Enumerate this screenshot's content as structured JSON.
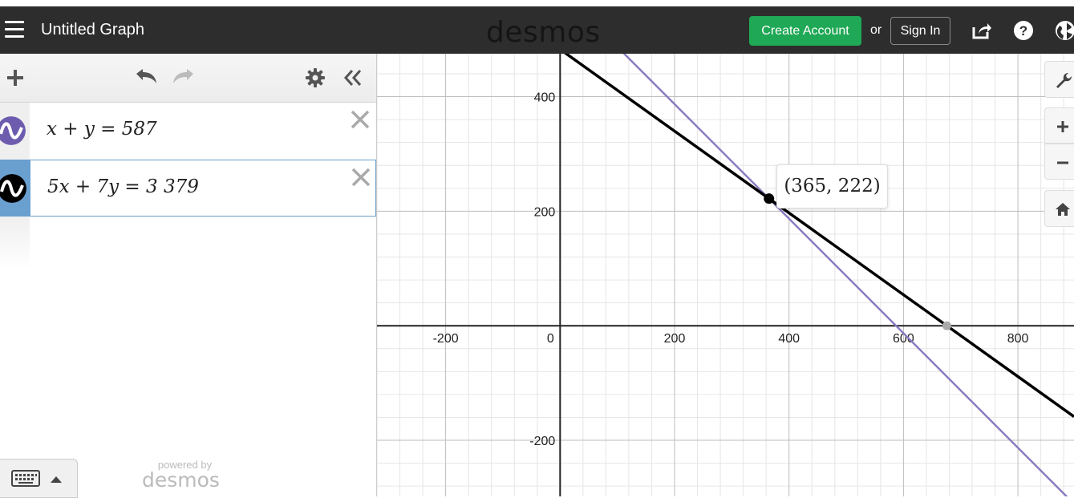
{
  "header": {
    "title": "Untitled Graph",
    "logo": "desmos",
    "create_account": "Create Account",
    "or": "or",
    "sign_in": "Sign In",
    "icons": [
      "menu-icon",
      "share-icon",
      "help-icon",
      "globe-icon"
    ]
  },
  "expressions": [
    {
      "text": "x + y = 587",
      "color": "#6d5cae"
    },
    {
      "text": "5x + 7y = 3 379",
      "color": "#000000"
    }
  ],
  "footer": {
    "powered_by": "powered by",
    "brand": "desmos"
  },
  "tooltip": "(365, 222)",
  "colors": {
    "line1": "#8b7cbf",
    "line2": "#000000",
    "header_bg": "#2d2d2d",
    "create_account_bg": "#1fa855"
  },
  "chart_data": {
    "type": "line",
    "series": [
      {
        "equation": "x + y = 587",
        "color": "#8b7cbf"
      },
      {
        "equation": "5x + 7y = 3 379",
        "color": "#000000"
      }
    ],
    "intersection": [
      365,
      222
    ],
    "x_ticks": [
      -200,
      0,
      200,
      400,
      600,
      800
    ],
    "y_ticks": [
      400,
      200,
      -200
    ],
    "xlim": [
      -320,
      898
    ],
    "ylim": [
      -298,
      475
    ],
    "grid": true
  }
}
